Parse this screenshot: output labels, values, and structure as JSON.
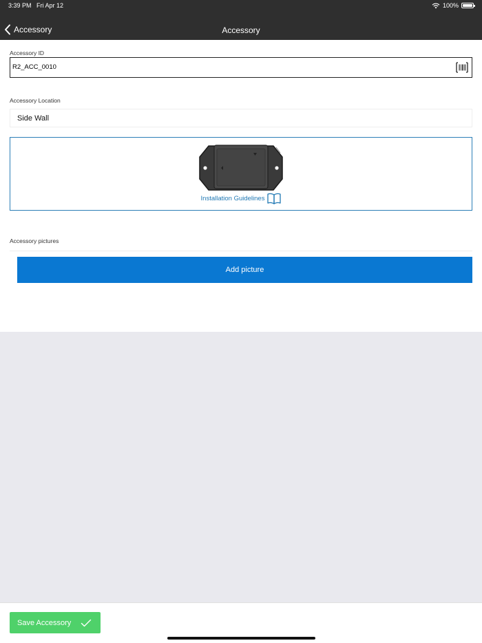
{
  "status_bar": {
    "time": "3:39 PM",
    "date": "Fri Apr 12",
    "battery": "100%",
    "wifi_icon": "wifi-icon",
    "battery_icon": "battery-icon"
  },
  "nav": {
    "back_label": "Accessory",
    "title": "Accessory",
    "back_icon": "chevron-left-icon"
  },
  "form": {
    "accessory_id": {
      "label": "Accessory ID",
      "value": "R2_ACC_0010",
      "scan_icon": "barcode-icon"
    },
    "location": {
      "label": "Accessory Location",
      "value": "Side Wall"
    },
    "guidelines": {
      "link_text": "Installation Guidelines",
      "icon": "book-icon",
      "image": "sensor-device-image"
    },
    "pictures": {
      "label": "Accessory pictures",
      "add_button": "Add picture"
    }
  },
  "footer": {
    "save_label": "Save Accessory",
    "save_icon": "check-icon"
  },
  "colors": {
    "nav_background": "#2f2f2f",
    "primary_blue": "#0a78d2",
    "link_blue": "#1f78b4",
    "save_green": "#4fd16a",
    "grey_background": "#e9e9ee"
  }
}
